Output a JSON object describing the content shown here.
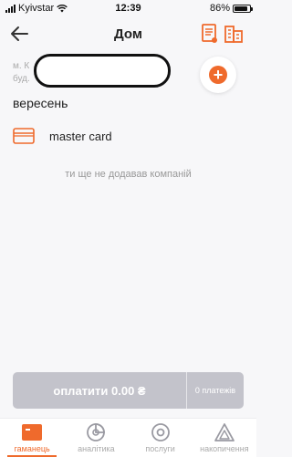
{
  "status_bar": {
    "carrier": "Kyivstar",
    "time": "12:39",
    "battery": "86%",
    "battery_level": 0.86
  },
  "header": {
    "title": "Дом"
  },
  "address": {
    "line1": "м. К",
    "line2": "буд."
  },
  "month": "вересень",
  "card": {
    "label": "master card"
  },
  "empty_message": "ти ще не додавав компаній",
  "pay": {
    "label": "оплатити 0.00 ₴",
    "count": "0 платежів"
  },
  "tabs": [
    {
      "label": "гаманець",
      "icon": "wallet-icon",
      "active": true
    },
    {
      "label": "аналітика",
      "icon": "analytics-icon",
      "active": false
    },
    {
      "label": "послуги",
      "icon": "services-icon",
      "active": false
    },
    {
      "label": "накопичення",
      "icon": "savings-icon",
      "active": false
    }
  ],
  "colors": {
    "accent": "#ef6a2c",
    "pay_button": "#c3c3cb",
    "background": "#f7f7f9"
  }
}
